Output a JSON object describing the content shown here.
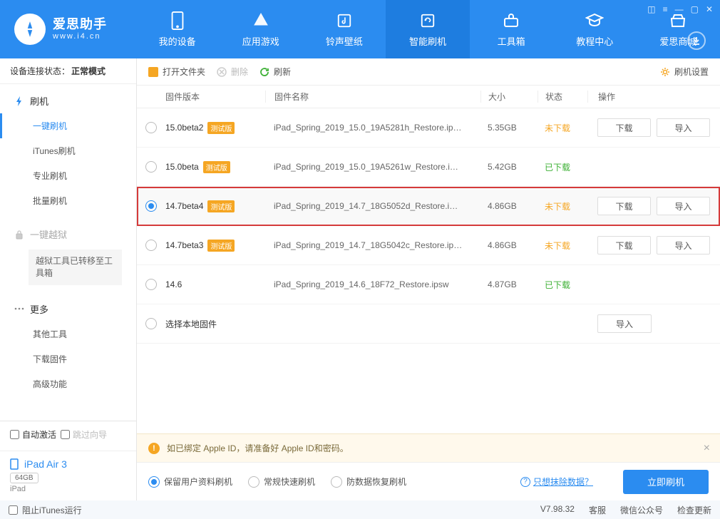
{
  "header": {
    "logo_title": "爱思助手",
    "logo_sub": "www.i4.cn",
    "nav": [
      {
        "label": "我的设备"
      },
      {
        "label": "应用游戏"
      },
      {
        "label": "铃声壁纸"
      },
      {
        "label": "智能刷机"
      },
      {
        "label": "工具箱"
      },
      {
        "label": "教程中心"
      },
      {
        "label": "爱思商城"
      }
    ]
  },
  "sidebar": {
    "conn_prefix": "设备连接状态：",
    "conn_state": "正常模式",
    "group_flash": "刷机",
    "items_flash": [
      "一键刷机",
      "iTunes刷机",
      "专业刷机",
      "批量刷机"
    ],
    "group_jailbreak": "一键越狱",
    "jailbreak_notice": "越狱工具已转移至工具箱",
    "group_more": "更多",
    "items_more": [
      "其他工具",
      "下载固件",
      "高级功能"
    ],
    "auto_activate": "自动激活",
    "skip_guide": "跳过向导",
    "device_name": "iPad Air 3",
    "device_capacity": "64GB",
    "device_type": "iPad"
  },
  "toolbar": {
    "open_folder": "打开文件夹",
    "delete": "删除",
    "refresh": "刷新",
    "settings": "刷机设置"
  },
  "table": {
    "headers": {
      "version": "固件版本",
      "name": "固件名称",
      "size": "大小",
      "status": "状态",
      "ops": "操作"
    },
    "btn_download": "下载",
    "btn_import": "导入",
    "tag_beta": "测试版",
    "status_no": "未下载",
    "status_yes": "已下载",
    "local_label": "选择本地固件",
    "rows": [
      {
        "version": "15.0beta2",
        "beta": true,
        "name": "iPad_Spring_2019_15.0_19A5281h_Restore.ip…",
        "size": "5.35GB",
        "status": "no",
        "dl": true,
        "imp": true,
        "sel": false
      },
      {
        "version": "15.0beta",
        "beta": true,
        "name": "iPad_Spring_2019_15.0_19A5261w_Restore.i…",
        "size": "5.42GB",
        "status": "yes",
        "dl": false,
        "imp": false,
        "sel": false
      },
      {
        "version": "14.7beta4",
        "beta": true,
        "name": "iPad_Spring_2019_14.7_18G5052d_Restore.i…",
        "size": "4.86GB",
        "status": "no",
        "dl": true,
        "imp": true,
        "sel": true,
        "highlight": true
      },
      {
        "version": "14.7beta3",
        "beta": true,
        "name": "iPad_Spring_2019_14.7_18G5042c_Restore.ip…",
        "size": "4.86GB",
        "status": "no",
        "dl": true,
        "imp": true,
        "sel": false
      },
      {
        "version": "14.6",
        "beta": false,
        "name": "iPad_Spring_2019_14.6_18F72_Restore.ipsw",
        "size": "4.87GB",
        "status": "yes",
        "dl": false,
        "imp": false,
        "sel": false
      }
    ]
  },
  "tip": "如已绑定 Apple ID，请准备好 Apple ID和密码。",
  "action": {
    "modes": [
      "保留用户资料刷机",
      "常规快速刷机",
      "防数据恢复刷机"
    ],
    "link": "只想抹除数据？",
    "flash_btn": "立即刷机"
  },
  "footer": {
    "block_itunes": "阻止iTunes运行",
    "version": "V7.98.32",
    "items": [
      "客服",
      "微信公众号",
      "检查更新"
    ]
  }
}
